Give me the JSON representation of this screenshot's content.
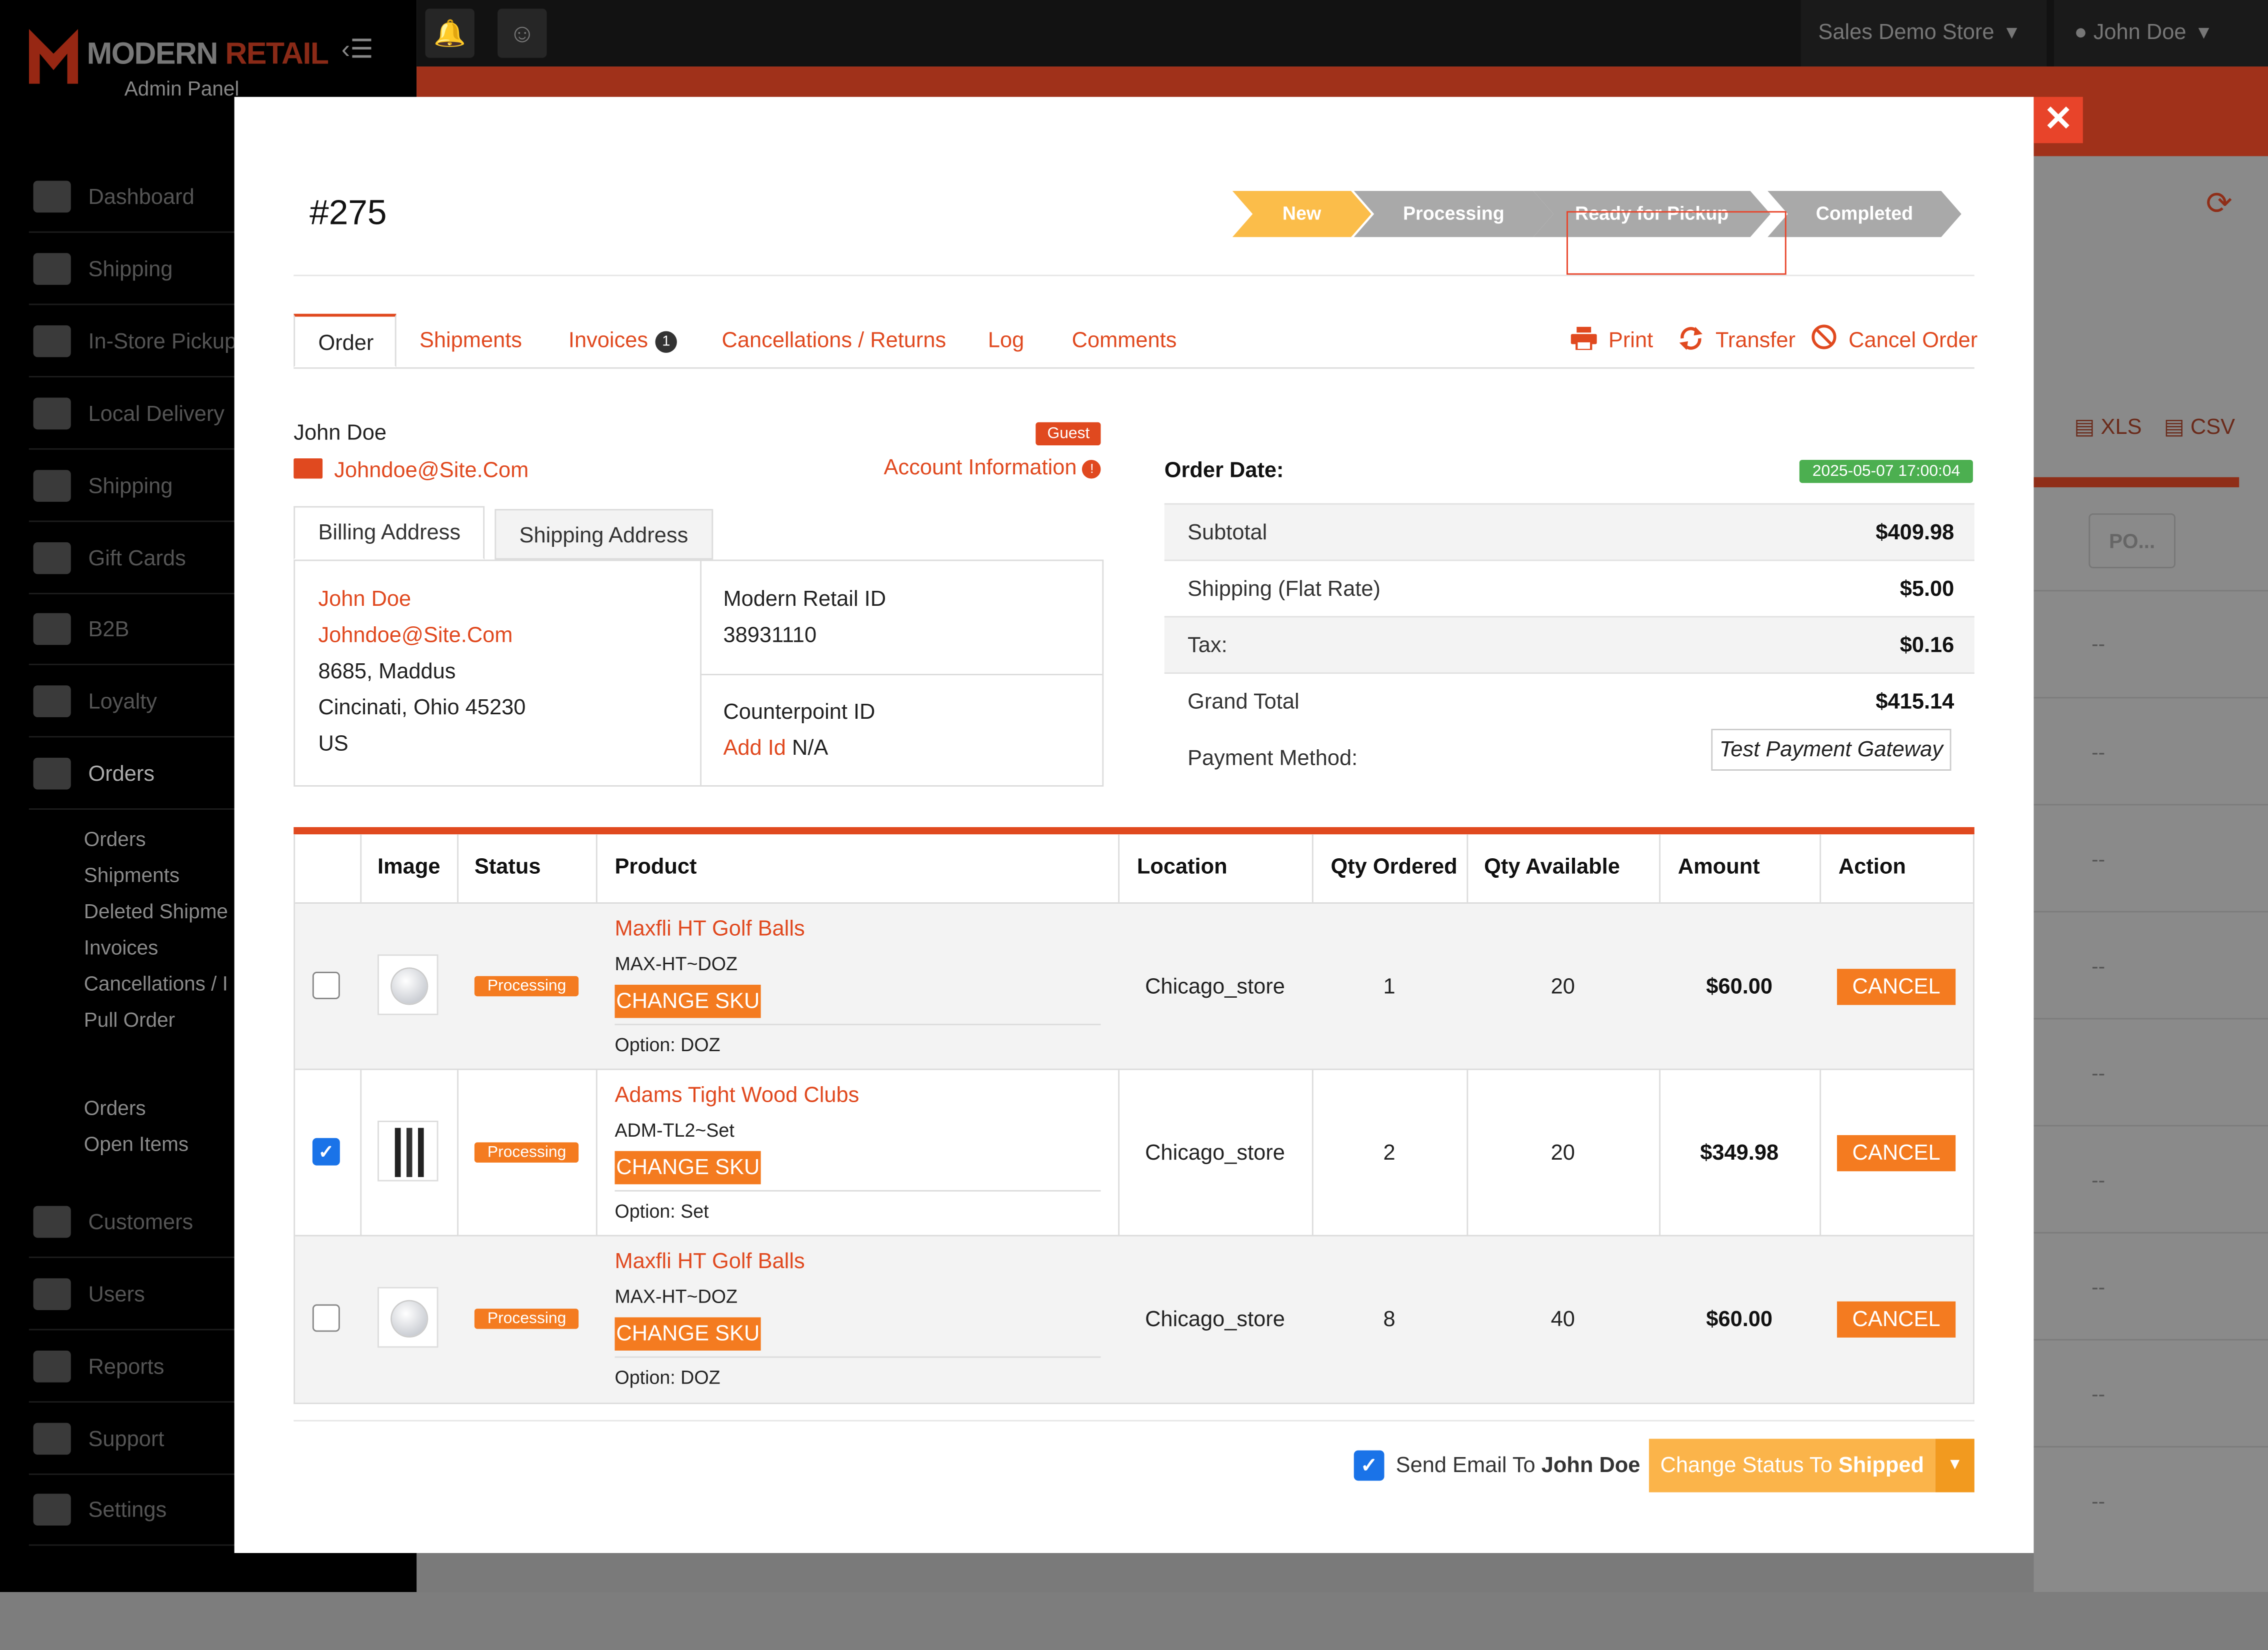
{
  "app": {
    "logo_primary": "MODERN",
    "logo_accent": "RETAIL",
    "logo_sub": "Admin Panel",
    "store_selector": "Sales Demo Store",
    "user_menu": "John Doe"
  },
  "sidebar": {
    "items": [
      {
        "label": "Dashboard",
        "icon": "dashboard-icon"
      },
      {
        "label": "Shipping",
        "icon": "barcode-icon"
      },
      {
        "label": "In-Store Pickup",
        "icon": "store-icon"
      },
      {
        "label": "Local Delivery",
        "icon": "bike-icon"
      },
      {
        "label": "Shipping",
        "icon": "box-icon"
      },
      {
        "label": "Gift Cards",
        "icon": "gift-card-icon"
      },
      {
        "label": "B2B",
        "icon": "group-icon"
      },
      {
        "label": "Loyalty",
        "icon": "loyalty-icon"
      },
      {
        "label": "Orders",
        "icon": "orders-icon"
      }
    ],
    "orders_sub": [
      "Orders",
      "Shipments",
      "Deleted Shipme",
      "Invoices",
      "Cancellations / I",
      "Pull Order"
    ],
    "orders_sub2": [
      "Orders",
      "Open Items"
    ],
    "items_bottom": [
      {
        "label": "Customers",
        "icon": "customers-icon"
      },
      {
        "label": "Users",
        "icon": "user-icon"
      },
      {
        "label": "Reports",
        "icon": "chart-icon"
      },
      {
        "label": "Support",
        "icon": "support-icon"
      },
      {
        "label": "Settings",
        "icon": "wrench-icon"
      }
    ]
  },
  "background": {
    "export_xls": "XLS",
    "export_csv": "CSV",
    "po_header": "PO...",
    "empty_cell": "--"
  },
  "order": {
    "number": "#275",
    "status_steps": [
      "New",
      "Processing",
      "Ready for Pickup",
      "Completed"
    ],
    "current_step": "New",
    "tabs": [
      "Order",
      "Shipments",
      "Invoices",
      "Cancellations / Returns",
      "Log",
      "Comments"
    ],
    "invoice_count": "1",
    "actions": {
      "print": "Print",
      "transfer": "Transfer",
      "cancel": "Cancel Order"
    },
    "customer": {
      "name": "John Doe",
      "badge": "Guest",
      "email": "Johndoe@Site.Com",
      "account_info": "Account Information"
    },
    "address_tabs": [
      "Billing Address",
      "Shipping Address"
    ],
    "billing": {
      "name": "John Doe",
      "email": "Johndoe@Site.Com",
      "line1": "8685, Maddus",
      "line2": "Cincinati, Ohio 45230",
      "country": "US"
    },
    "modern_retail_id_label": "Modern Retail ID",
    "modern_retail_id": "38931110",
    "counterpoint_id_label": "Counterpoint ID",
    "counterpoint_add": "Add Id",
    "counterpoint_value": "N/A",
    "order_date_label": "Order Date:",
    "order_date": "2025-05-07 17:00:04",
    "totals": {
      "subtotal_label": "Subtotal",
      "subtotal": "$409.98",
      "shipping_label": "Shipping (Flat Rate)",
      "shipping": "$5.00",
      "tax_label": "Tax:",
      "tax": "$0.16",
      "grand_label": "Grand Total",
      "grand": "$415.14",
      "payment_label": "Payment Method:",
      "payment": "Test Payment Gateway"
    },
    "item_columns": [
      "Image",
      "Status",
      "Product",
      "Location",
      "Qty Ordered",
      "Qty Available",
      "Amount",
      "Action"
    ],
    "items": [
      {
        "checked": false,
        "image": "golf-ball-image",
        "status": "Processing",
        "name": "Maxfli HT Golf Balls",
        "sku": "MAX-HT~DOZ",
        "change_sku": "CHANGE SKU",
        "option": "Option: DOZ",
        "location": "Chicago_store",
        "qty_ordered": "1",
        "qty_available": "20",
        "amount": "$60.00",
        "action": "CANCEL"
      },
      {
        "checked": true,
        "image": "golf-clubs-image",
        "status": "Processing",
        "name": "Adams Tight Wood Clubs",
        "sku": "ADM-TL2~Set",
        "change_sku": "CHANGE SKU",
        "option": "Option: Set",
        "location": "Chicago_store",
        "qty_ordered": "2",
        "qty_available": "20",
        "amount": "$349.98",
        "action": "CANCEL"
      },
      {
        "checked": false,
        "image": "golf-ball-image",
        "status": "Processing",
        "name": "Maxfli HT Golf Balls",
        "sku": "MAX-HT~DOZ",
        "change_sku": "CHANGE SKU",
        "option": "Option: DOZ",
        "location": "Chicago_store",
        "qty_ordered": "8",
        "qty_available": "40",
        "amount": "$60.00",
        "action": "CANCEL"
      }
    ],
    "footer": {
      "send_email_prefix": "Send Email To",
      "send_email_name": "John Doe",
      "status_button_prefix": "Change Status To",
      "status_button_target": "Shipped"
    }
  },
  "colors": {
    "accent": "#e0491f",
    "step_active": "#fbbd4a",
    "step_inactive": "#a9a9a9",
    "status_badge": "#f47b20",
    "date_badge": "#4caf50",
    "checkbox": "#1a73e8"
  }
}
